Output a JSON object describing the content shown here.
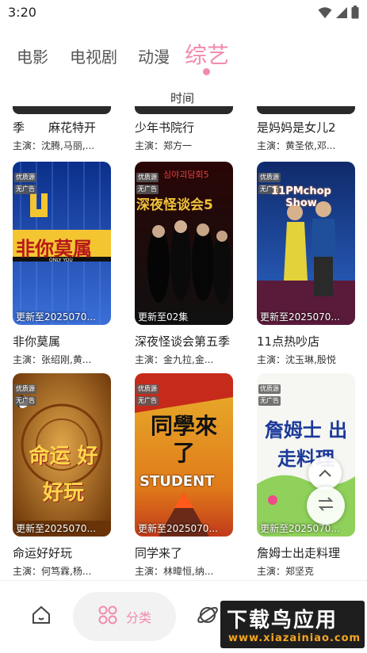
{
  "status_bar": {
    "time": "3:20",
    "wifi_icon": "wifi-icon",
    "signal_icon": "signal-icon",
    "battery_icon": "battery-icon"
  },
  "tabs": [
    {
      "label": "电影",
      "active": false
    },
    {
      "label": "电视剧",
      "active": false
    },
    {
      "label": "动漫",
      "active": false
    },
    {
      "label": "综艺",
      "active": true
    }
  ],
  "sort": {
    "label": "时间"
  },
  "partial_row": [
    {
      "title": "季　　麻花特开",
      "cast": "主演：沈腾,马丽,..."
    },
    {
      "title": "少年书院行",
      "cast": "主演：郑方一"
    },
    {
      "title": "是妈妈是女儿2",
      "cast": "主演：黄圣依,邓..."
    }
  ],
  "cards": [
    {
      "title": "非你莫属",
      "cast": "主演：张绍刚,黄...",
      "update": "更新至2025070...",
      "badges": [
        "优质源",
        "无广告"
      ],
      "poster_text": "非你莫属",
      "poster_sub": "ONLY YOU",
      "colors": {
        "bg1": "#0b2f8a",
        "bg2": "#3b6fd8",
        "accent": "#f3c531"
      }
    },
    {
      "title": "深夜怪谈会第五季",
      "cast": "主演：金九拉,金...",
      "update": "更新至02集",
      "badges": [
        "优质源",
        "无广告"
      ],
      "poster_text": "深夜怪谈会5",
      "poster_sub": "심야괴담회5",
      "colors": {
        "bg1": "#1a1a1a",
        "bg2": "#5a1010",
        "accent": "#f0c23a"
      }
    },
    {
      "title": "11点热吵店",
      "cast": "主演：沈玉琳,殷悦",
      "update": "更新至2025070...",
      "badges": [
        "优质源",
        "无广告"
      ],
      "poster_text": "11PMchop Show",
      "poster_sub": "",
      "colors": {
        "bg1": "#0f2a6b",
        "bg2": "#2d66c9",
        "accent": "#ff7a1a"
      }
    },
    {
      "title": "命运好好玩",
      "cast": "主演：何笃霖,杨...",
      "update": "更新至2025070...",
      "badges": [
        "优质源",
        "无广告"
      ],
      "poster_text": "命运 好好玩",
      "poster_sub": "",
      "colors": {
        "bg1": "#8a4a12",
        "bg2": "#e1a548",
        "accent": "#ffd84a"
      }
    },
    {
      "title": "同学来了",
      "cast": "主演：林暐恒,纳...",
      "update": "更新至2025070...",
      "badges": [
        "优质源",
        "无广告"
      ],
      "poster_text": "同學來了",
      "poster_sub": "STUDENT",
      "colors": {
        "bg1": "#e8b22c",
        "bg2": "#c23a1a",
        "accent": "#111111"
      }
    },
    {
      "title": "詹姆士出走料理",
      "cast": "主演：郑坚克",
      "update": "更新至2025070...",
      "badges": [
        "优质源",
        "无广告"
      ],
      "poster_text": "詹姆士 出走料理",
      "poster_sub": "",
      "colors": {
        "bg1": "#ffffff",
        "bg2": "#8fd15a",
        "accent": "#1c3a9a"
      }
    }
  ],
  "fabs": {
    "scroll_top_icon": "chevron-up-icon",
    "switch_icon": "swap-icon"
  },
  "bottom_nav": {
    "home_icon": "home-icon",
    "category_label": "分类",
    "category_icon": "category-icon",
    "explore_icon": "planet-icon"
  },
  "watermark": {
    "main": "下载鸟应用",
    "sub": "www.xiazainiao.com"
  }
}
